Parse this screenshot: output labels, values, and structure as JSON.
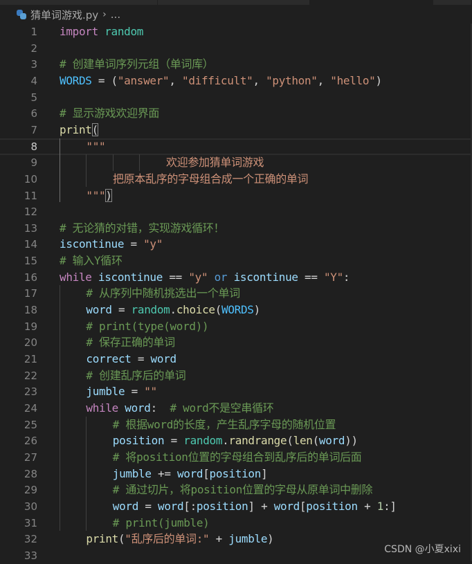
{
  "tabs": [
    {
      "label": "",
      "active": false
    },
    {
      "label": "",
      "active": false
    },
    {
      "label": "",
      "active": true
    },
    {
      "label": "",
      "active": false
    }
  ],
  "breadcrumb": {
    "file_icon": "python-file-icon",
    "file": "猜单词游戏.py",
    "separator": "›",
    "more": "..."
  },
  "editor": {
    "language": "python",
    "current_line": 8,
    "lines": [
      {
        "n": "1",
        "text": "import random"
      },
      {
        "n": "2",
        "text": ""
      },
      {
        "n": "3",
        "text": "# 创建单词序列元组（单词库）"
      },
      {
        "n": "4",
        "text": "WORDS = (\"answer\", \"difficult\", \"python\", \"hello\")"
      },
      {
        "n": "5",
        "text": ""
      },
      {
        "n": "6",
        "text": "# 显示游戏欢迎界面"
      },
      {
        "n": "7",
        "text": "print("
      },
      {
        "n": "8",
        "text": "    \"\"\""
      },
      {
        "n": "9",
        "text": "\t\t\t欢迎参加猜单词游戏"
      },
      {
        "n": "10",
        "text": "\t把原本乱序的字母组合成一个正确的单词"
      },
      {
        "n": "11",
        "text": "    \"\"\")"
      },
      {
        "n": "12",
        "text": ""
      },
      {
        "n": "13",
        "text": "# 无论猜的对错，实现游戏循环！"
      },
      {
        "n": "14",
        "text": "iscontinue = \"y\""
      },
      {
        "n": "15",
        "text": "# 输入Y循环"
      },
      {
        "n": "16",
        "text": "while iscontinue == \"y\" or iscontinue == \"Y\":"
      },
      {
        "n": "17",
        "text": "    # 从序列中随机挑选出一个单词"
      },
      {
        "n": "18",
        "text": "    word = random.choice(WORDS)"
      },
      {
        "n": "19",
        "text": "    # print(type(word))"
      },
      {
        "n": "20",
        "text": "    # 保存正确的单词"
      },
      {
        "n": "21",
        "text": "    correct = word"
      },
      {
        "n": "22",
        "text": "    # 创建乱序后的单词"
      },
      {
        "n": "23",
        "text": "    jumble = \"\""
      },
      {
        "n": "24",
        "text": "    while word:  # word不是空串循环"
      },
      {
        "n": "25",
        "text": "        # 根据word的长度，产生乱序字母的随机位置"
      },
      {
        "n": "26",
        "text": "        position = random.randrange(len(word))"
      },
      {
        "n": "27",
        "text": "        # 将position位置的字母组合到乱序后的单词后面"
      },
      {
        "n": "28",
        "text": "        jumble += word[position]"
      },
      {
        "n": "29",
        "text": "        # 通过切片，将position位置的字母从原单词中删除"
      },
      {
        "n": "30",
        "text": "        word = word[:position] + word[position + 1:]"
      },
      {
        "n": "31",
        "text": "        # print(jumble)"
      },
      {
        "n": "32",
        "text": "    print(\"乱序后的单词:\" + jumble)"
      },
      {
        "n": "33",
        "text": ""
      }
    ],
    "tokens": {
      "l1": [
        "import",
        " ",
        "random"
      ],
      "l3": "# 创建单词序列元组（单词库）",
      "l4": [
        "WORDS",
        " = (",
        "\"answer\"",
        ", ",
        "\"difficult\"",
        ", ",
        "\"python\"",
        ", ",
        "\"hello\"",
        ")"
      ],
      "l6": "# 显示游戏欢迎界面",
      "l7": [
        "print",
        "("
      ],
      "l8": "\"\"\"",
      "l9": "欢迎参加猜单词游戏",
      "l10": "把原本乱序的字母组合成一个正确的单词",
      "l11": [
        "\"\"\"",
        ")"
      ],
      "l13": "# 无论猜的对错，实现游戏循环！",
      "l14": [
        "iscontinue",
        " = ",
        "\"y\""
      ],
      "l15": "# 输入Y循环",
      "l16": [
        "while",
        " ",
        "iscontinue",
        " == ",
        "\"y\"",
        " ",
        "or",
        " ",
        "iscontinue",
        " == ",
        "\"Y\"",
        ":"
      ],
      "l17": "# 从序列中随机挑选出一个单词",
      "l18": [
        "word",
        " = ",
        "random",
        ".",
        "choice",
        "(",
        "WORDS",
        ")"
      ],
      "l19": "# print(type(word))",
      "l20": "# 保存正确的单词",
      "l21": [
        "correct",
        " = ",
        "word"
      ],
      "l22": "# 创建乱序后的单词",
      "l23": [
        "jumble",
        " = ",
        "\"\""
      ],
      "l24": [
        "while",
        " ",
        "word",
        ":  ",
        "# word不是空串循环"
      ],
      "l25": "# 根据word的长度，产生乱序字母的随机位置",
      "l26": [
        "position",
        " = ",
        "random",
        ".",
        "randrange",
        "(",
        "len",
        "(",
        "word",
        "))"
      ],
      "l27": "# 将position位置的字母组合到乱序后的单词后面",
      "l28": [
        "jumble",
        " += ",
        "word",
        "[",
        "position",
        "]"
      ],
      "l29": "# 通过切片，将position位置的字母从原单词中删除",
      "l30": [
        "word",
        " = ",
        "word",
        "[:",
        "position",
        "] + ",
        "word",
        "[",
        "position",
        " + ",
        "1",
        ":]"
      ],
      "l31": "# print(jumble)",
      "l32": [
        "print",
        "(",
        "\"乱序后的单词:\"",
        " + ",
        "jumble",
        ")"
      ]
    }
  },
  "watermark": "CSDN @小夏xixi",
  "colors": {
    "background": "#1f1f1f",
    "keyword": "#c586c0",
    "keyword_operator": "#569cd6",
    "module": "#4ec9b0",
    "function": "#dcdcaa",
    "variable": "#9cdcfe",
    "constant": "#4fc1ff",
    "string": "#ce9178",
    "comment": "#6a9955",
    "number": "#b5cea8",
    "line_number": "#858585"
  }
}
